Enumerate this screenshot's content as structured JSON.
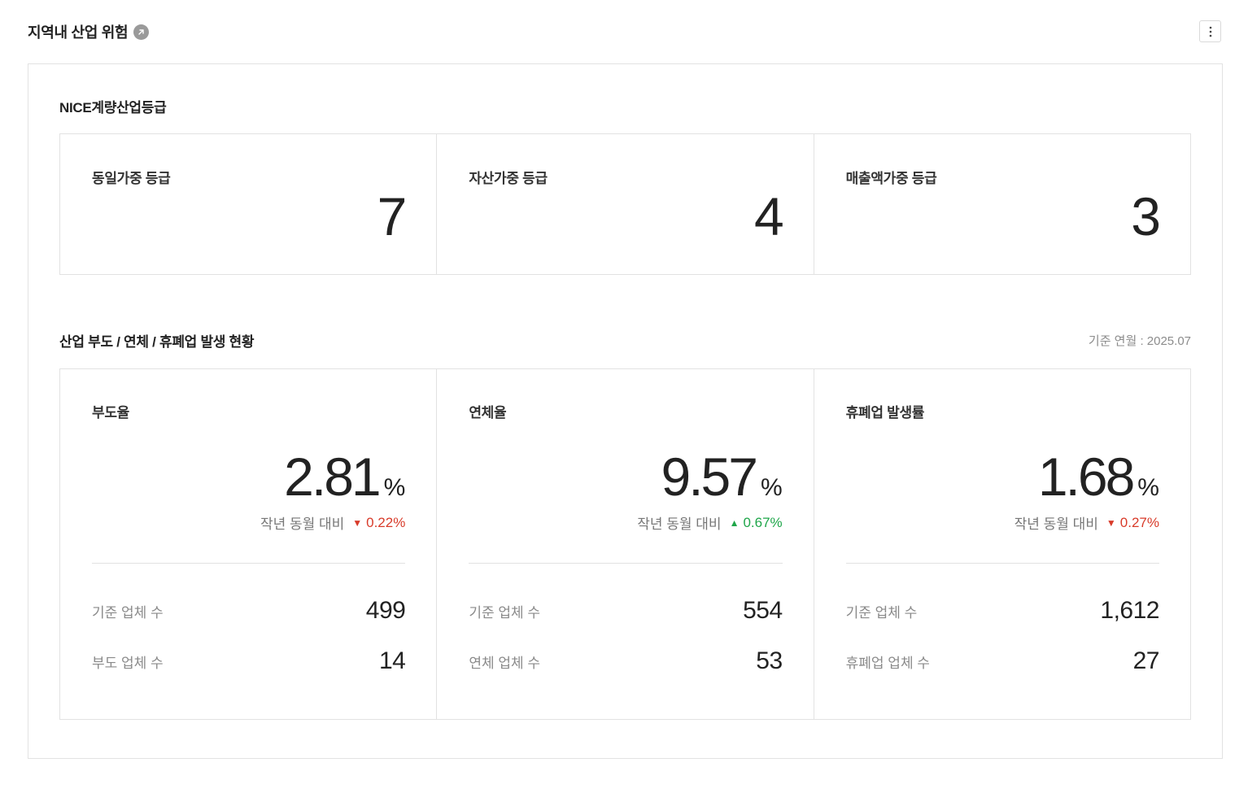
{
  "header": {
    "title": "지역내 산업 위험",
    "link_icon": "arrow-up-right-icon",
    "more_icon": "more-vertical-icon"
  },
  "grade_section": {
    "title": "NICE계량산업등급",
    "cards": [
      {
        "label": "동일가중 등급",
        "value": "7"
      },
      {
        "label": "자산가중 등급",
        "value": "4"
      },
      {
        "label": "매출액가중 등급",
        "value": "3"
      }
    ]
  },
  "status_section": {
    "title": "산업 부도 / 연체 / 휴폐업 발생 현황",
    "base_date": "기준 연월 : 2025.07",
    "cards": [
      {
        "label": "부도율",
        "rate": "2.81",
        "unit": "%",
        "yoy_label": "작년 동월 대비",
        "yoy_direction": "down",
        "yoy_arrow": "▼",
        "yoy_value": "0.22%",
        "stats": [
          {
            "label": "기준 업체 수",
            "value": "499"
          },
          {
            "label": "부도 업체 수",
            "value": "14"
          }
        ]
      },
      {
        "label": "연체율",
        "rate": "9.57",
        "unit": "%",
        "yoy_label": "작년 동월 대비",
        "yoy_direction": "up",
        "yoy_arrow": "▲",
        "yoy_value": "0.67%",
        "stats": [
          {
            "label": "기준 업체 수",
            "value": "554"
          },
          {
            "label": "연체 업체 수",
            "value": "53"
          }
        ]
      },
      {
        "label": "휴폐업 발생률",
        "rate": "1.68",
        "unit": "%",
        "yoy_label": "작년 동월 대비",
        "yoy_direction": "down",
        "yoy_arrow": "▼",
        "yoy_value": "0.27%",
        "stats": [
          {
            "label": "기준 업체 수",
            "value": "1,612"
          },
          {
            "label": "휴폐업 업체 수",
            "value": "27"
          }
        ]
      }
    ]
  },
  "colors": {
    "down": "#d83b2a",
    "up": "#1fa64a",
    "border": "#e2e2e2"
  }
}
